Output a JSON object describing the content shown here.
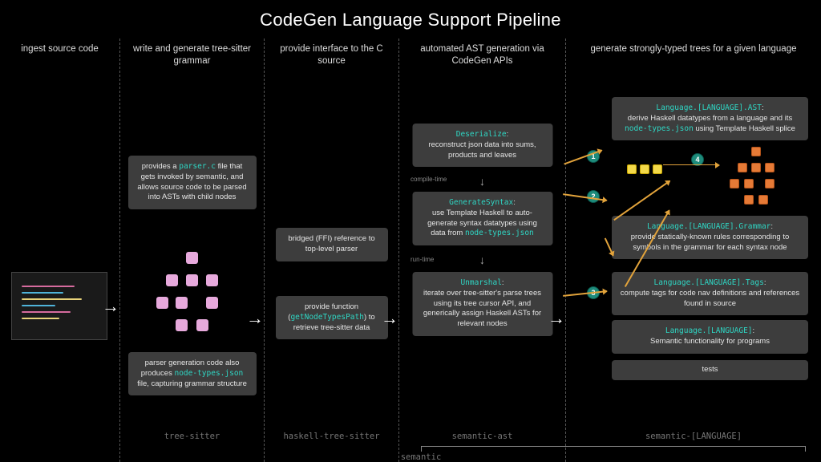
{
  "title": "CodeGen Language Support Pipeline",
  "columns": [
    {
      "header": "ingest source code",
      "footer": ""
    },
    {
      "header": "write and generate tree-sitter grammar",
      "footer": "tree-sitter"
    },
    {
      "header": "provide interface to the C source",
      "footer": "haskell-tree-sitter"
    },
    {
      "header": "automated AST generation via CodeGen APIs",
      "footer": "semantic-ast"
    },
    {
      "header": "generate strongly-typed trees for a given language",
      "footer": "semantic-[LANGUAGE]"
    }
  ],
  "col1_card1_pre": "provides a ",
  "col1_card1_code": "parser.c",
  "col1_card1_post": " file that gets invoked by semantic, and allows source code to be parsed into ASTs with child nodes",
  "col1_card2_pre": "parser generation code also produces ",
  "col1_card2_code": "node-types.json",
  "col1_card2_post": " file, capturing grammar structure",
  "col2_card1": "bridged (FFI) reference to top-level parser",
  "col2_card2_pre": "provide function (",
  "col2_card2_code": "getNodeTypesPath",
  "col2_card2_post": ") to retrieve tree-sitter data",
  "col3_card1_title": "Deserialize",
  "col3_card1_body": "reconstruct json data into sums, products and leaves",
  "col3_card2_title": "GenerateSyntax",
  "col3_card2_body_pre": "use Template Haskell to auto-generate syntax datatypes using data from ",
  "col3_card2_body_code": "node-types.json",
  "col3_card3_title": "Unmarshal",
  "col3_card3_body": "iterate over tree-sitter's parse trees using its tree cursor API, and generically assign Haskell ASTs for relevant nodes",
  "col3_phase1": "compile-time",
  "col3_phase2": "run-time",
  "col4_card1_title": "Language.[LANGUAGE].AST",
  "col4_card1_body_pre": "derive Haskell datatypes from a language and its ",
  "col4_card1_body_code": "node-types.json",
  "col4_card1_body_post": " using Template Haskell splice",
  "col4_card2_title": "Language.[LANGUAGE].Grammar",
  "col4_card2_body": "provide statically-known rules corresponding to symbols in the grammar for each syntax node",
  "col4_card3_title": "Language.[LANGUAGE].Tags",
  "col4_card3_body": "compute tags for code nav definitions and references found in source",
  "col4_card4_title": "Language.[LANGUAGE]",
  "col4_card4_body": "Semantic functionality for programs",
  "col4_card5": "tests",
  "badges": [
    "1",
    "2",
    "3",
    "4"
  ],
  "bracket_label": "semantic",
  "src_colors": [
    "#d66b9e",
    "#4fb3d9",
    "#e8d37a",
    "#4fb3d9",
    "#d66b9e",
    "#e8d37a"
  ]
}
